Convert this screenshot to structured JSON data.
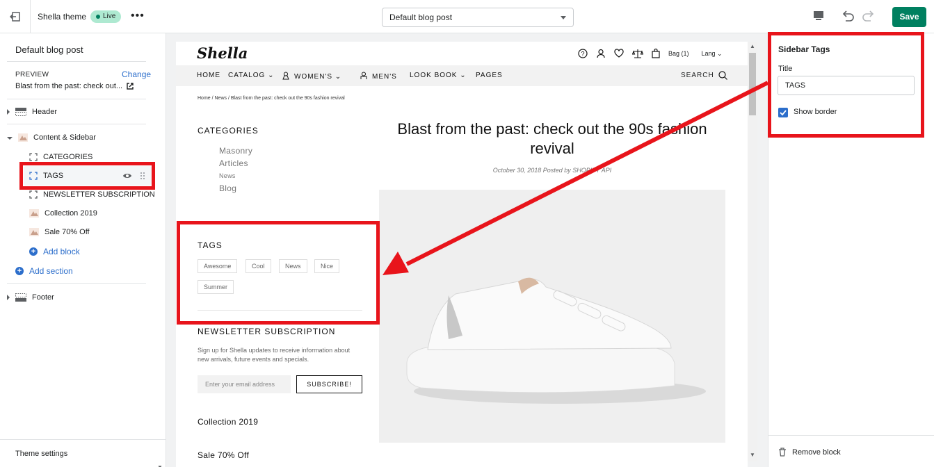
{
  "topbar": {
    "theme_name": "Shella theme",
    "live_badge": "Live",
    "more": "•••",
    "page_select": "Default blog post",
    "save_label": "Save"
  },
  "left_panel": {
    "title": "Default blog post",
    "preview_label": "PREVIEW",
    "change_label": "Change",
    "preview_value": "Blast from the past: check out...",
    "sections": [
      {
        "label": "Header"
      },
      {
        "label": "Content & Sidebar"
      },
      {
        "label": "Footer"
      }
    ],
    "blocks": [
      {
        "label": "CATEGORIES"
      },
      {
        "label": "TAGS"
      },
      {
        "label": "NEWSLETTER SUBSCRIPTION"
      },
      {
        "label": "Collection 2019"
      },
      {
        "label": "Sale 70% Off"
      }
    ],
    "add_block": "Add block",
    "add_section": "Add section",
    "theme_settings": "Theme settings"
  },
  "store": {
    "logo": "Shella",
    "bag": "Bag (1)",
    "lang": "Lang",
    "nav": [
      "HOME",
      "CATALOG",
      "WOMEN'S",
      "MEN'S",
      "LOOK BOOK",
      "PAGES"
    ],
    "search": "SEARCH",
    "breadcrumb": "Home  /  News  /  Blast from the past: check out the 90s fashion revival",
    "categories_title": "CATEGORIES",
    "categories": [
      "Masonry",
      "Articles",
      "News",
      "Blog"
    ],
    "tags_title": "TAGS",
    "tags": [
      "Awesome",
      "Cool",
      "News",
      "Nice",
      "Summer"
    ],
    "newsletter_title": "NEWSLETTER SUBSCRIPTION",
    "newsletter_text": "Sign up for Shella updates to receive information about new arrivals, future events and specials.",
    "email_placeholder": "Enter your email address",
    "subscribe": "SUBSCRIBE!",
    "collection": "Collection 2019",
    "sale": "Sale 70% Off",
    "post_title": "Blast from the past: check out the 90s fashion revival",
    "post_meta": "October 30, 2018 Posted by SHOPIFY API"
  },
  "right_panel": {
    "title": "Sidebar Tags",
    "field_label": "Title",
    "field_value": "TAGS",
    "checkbox_label": "Show border",
    "checkbox_checked": true,
    "remove_block": "Remove block"
  },
  "colors": {
    "accent": "#2c6ecb",
    "save": "#008060",
    "annotation": "#e8141b"
  }
}
